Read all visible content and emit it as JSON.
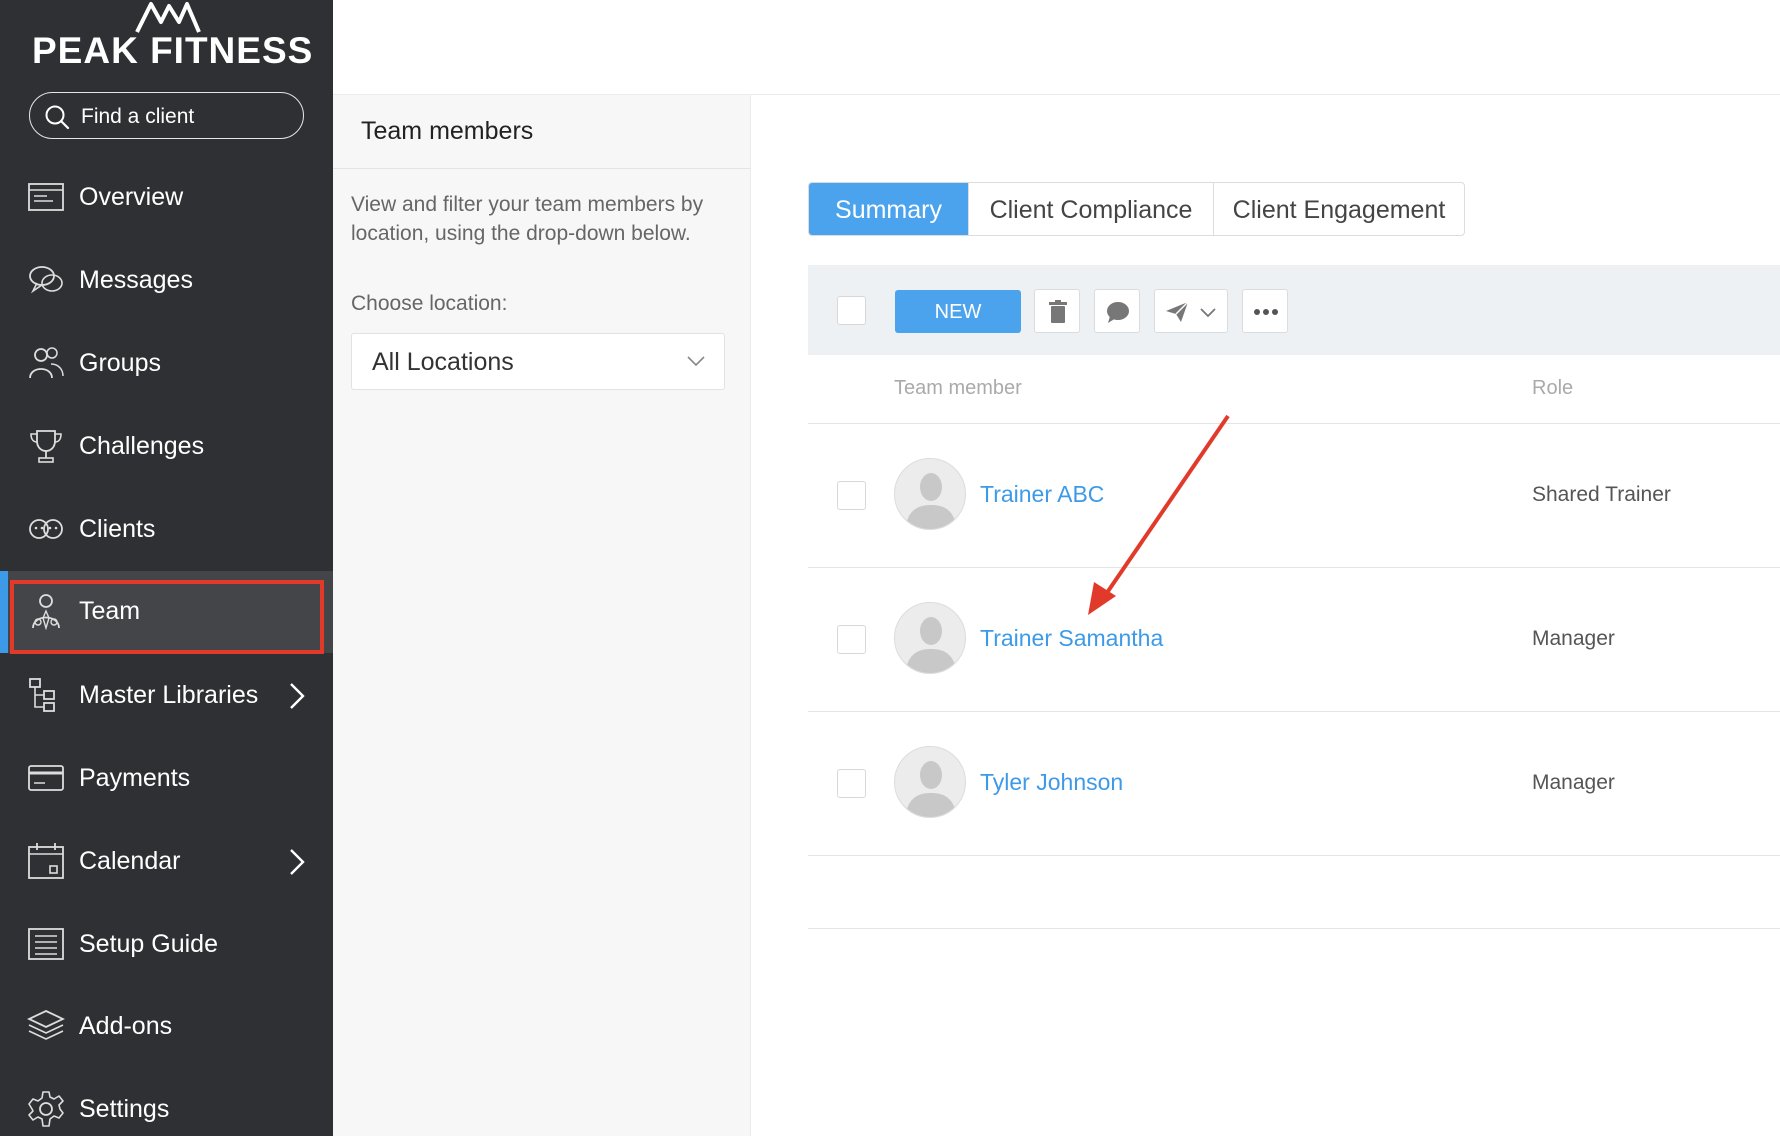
{
  "brand": {
    "name": "PEAK FITNESS"
  },
  "search": {
    "placeholder": "Find a client"
  },
  "sidebar": {
    "items": [
      {
        "label": "Overview",
        "icon": "overview-icon"
      },
      {
        "label": "Messages",
        "icon": "messages-icon"
      },
      {
        "label": "Groups",
        "icon": "groups-icon"
      },
      {
        "label": "Challenges",
        "icon": "trophy-icon"
      },
      {
        "label": "Clients",
        "icon": "clients-icon"
      },
      {
        "label": "Team",
        "icon": "team-icon",
        "active": true
      },
      {
        "label": "Master Libraries",
        "icon": "libraries-icon",
        "has_submenu": true
      },
      {
        "label": "Payments",
        "icon": "payments-icon"
      },
      {
        "label": "Calendar",
        "icon": "calendar-icon",
        "has_submenu": true
      },
      {
        "label": "Setup Guide",
        "icon": "setup-guide-icon"
      },
      {
        "label": "Add-ons",
        "icon": "addons-icon"
      },
      {
        "label": "Settings",
        "icon": "gear-icon"
      }
    ]
  },
  "panel": {
    "title": "Team members",
    "description": "View and filter your team members by location, using the drop-down below.",
    "choose_label": "Choose location:",
    "location": {
      "selected": "All Locations"
    }
  },
  "tabs": [
    {
      "label": "Summary",
      "active": true
    },
    {
      "label": "Client Compliance",
      "active": false
    },
    {
      "label": "Client Engagement",
      "active": false
    }
  ],
  "toolbar": {
    "new_label": "NEW",
    "icons": [
      "trash-icon",
      "chat-icon",
      "send-icon",
      "more-icon"
    ]
  },
  "table": {
    "columns": [
      "Team member",
      "Role"
    ],
    "rows": [
      {
        "name": "Trainer ABC",
        "role": "Shared Trainer"
      },
      {
        "name": "Trainer Samantha",
        "role": "Manager"
      },
      {
        "name": "Tyler Johnson",
        "role": "Manager"
      }
    ]
  },
  "colors": {
    "sidebar_bg": "#2f3033",
    "accent": "#4ba3ee",
    "highlight": "#e23a2a"
  }
}
